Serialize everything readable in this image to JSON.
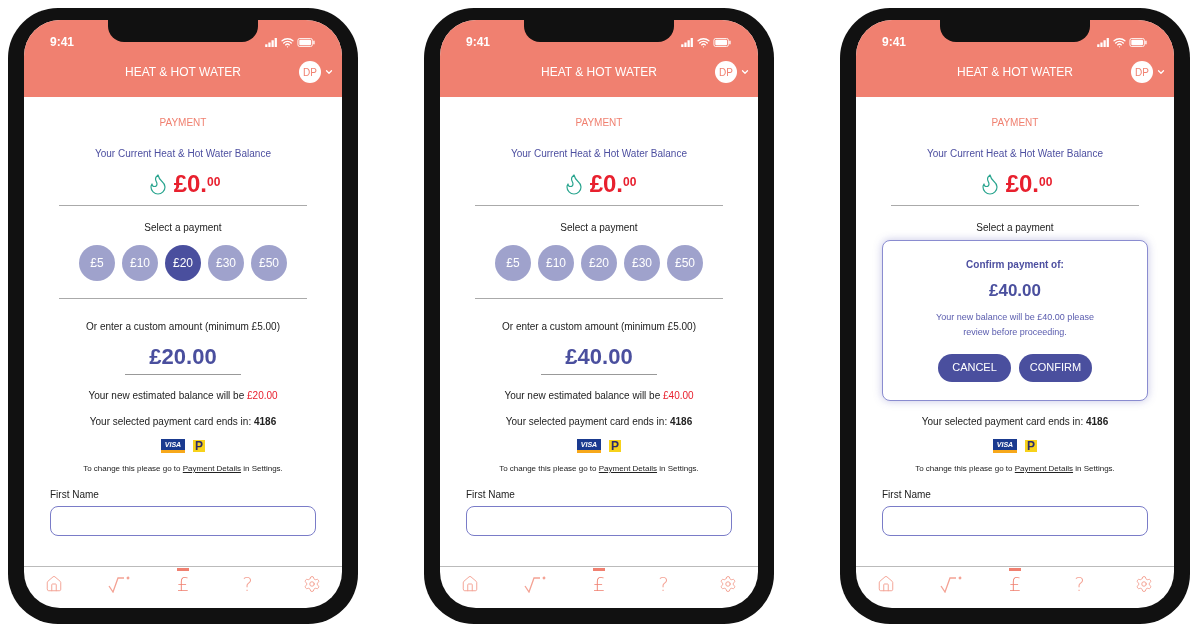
{
  "phones": [
    {
      "status": {
        "time": "9:41"
      },
      "header": {
        "title": "HEAT & HOT WATER",
        "avatar": "DP"
      },
      "section_title": "PAYMENT",
      "balance_label": "Your Current Heat & Hot Water Balance",
      "balance": "£0.$^{00}$",
      "select_label": "Select a payment",
      "chips": [
        {
          "label": "£5",
          "selected": false
        },
        {
          "label": "£10",
          "selected": false
        },
        {
          "label": "£20",
          "selected": true
        },
        {
          "label": "£30",
          "selected": false
        },
        {
          "label": "£50",
          "selected": false
        }
      ],
      "custom_label": "Or enter a custom amount (minimum £5.00)",
      "custom_amount": "£20.00",
      "estimate_label": "Your new estimated balance will be",
      "estimate_value": "£20.00",
      "card_text": "Your selected payment card ends in: **4186**",
      "logos": [
        {
          "kind": "visa",
          "text": "VISA"
        },
        {
          "kind": "paypoint",
          "text": "P"
        }
      ],
      "change_before": "To change this please go to",
      "change_link": "Payment Details",
      "change_after": "in Settings.",
      "first_name_label": "First Name",
      "tabs": [
        {
          "kind": "home",
          "selected": false
        },
        {
          "kind": "trend",
          "selected": false
        },
        {
          "kind": "glyph",
          "glyph": "£",
          "selected": true
        },
        {
          "kind": "glyph",
          "glyph": "?",
          "selected": false
        },
        {
          "kind": "settings",
          "selected": false
        }
      ]
    },
    {
      "status": {
        "time": "9:41"
      },
      "header": {
        "title": "HEAT & HOT WATER",
        "avatar": "DP"
      },
      "section_title": "PAYMENT",
      "balance_label": "Your Current Heat & Hot Water Balance",
      "balance": "£0.$^{00}$",
      "select_label": "Select a payment",
      "chips": [
        {
          "label": "£5",
          "selected": false
        },
        {
          "label": "£10",
          "selected": false
        },
        {
          "label": "£20",
          "selected": false
        },
        {
          "label": "£30",
          "selected": false
        },
        {
          "label": "£50",
          "selected": false
        }
      ],
      "custom_label": "Or enter a custom amount (minimum £5.00)",
      "custom_amount": "£40.00",
      "estimate_label": "Your new estimated balance will be",
      "estimate_value": "£40.00",
      "card_text": "Your selected payment card ends in: **4186**",
      "logos": [
        {
          "kind": "visa",
          "text": "VISA"
        },
        {
          "kind": "paypoint",
          "text": "P"
        }
      ],
      "change_before": "To change this please go to",
      "change_link": "Payment Details",
      "change_after": "in Settings.",
      "first_name_label": "First Name",
      "tabs": [
        {
          "kind": "home",
          "selected": false
        },
        {
          "kind": "trend",
          "selected": false
        },
        {
          "kind": "glyph",
          "glyph": "£",
          "selected": true
        },
        {
          "kind": "glyph",
          "glyph": "?",
          "selected": false
        },
        {
          "kind": "settings",
          "selected": false
        }
      ]
    },
    {
      "status": {
        "time": "9:41"
      },
      "header": {
        "title": "HEAT & HOT WATER",
        "avatar": "DP"
      },
      "section_title": "PAYMENT",
      "balance_label": "Your Current Heat & Hot Water Balance",
      "balance": "£0.$^{00}$",
      "select_label": "Select a payment",
      "card_text": "Your selected payment card ends in: **4186**",
      "logos": [
        {
          "kind": "visa",
          "text": "VISA"
        },
        {
          "kind": "paypoint",
          "text": "P"
        }
      ],
      "change_before": "To change this please go to",
      "change_link": "Payment Details",
      "change_after": "in Settings.",
      "first_name_label": "First Name",
      "dialog": {
        "title": "Confirm payment of:",
        "amount": "£40.00",
        "message": "Your new balance will be £40.00 please review before proceeding.",
        "buttons": [
          "CANCEL",
          "CONFIRM"
        ]
      },
      "tabs": [
        {
          "kind": "home",
          "selected": false
        },
        {
          "kind": "trend",
          "selected": false
        },
        {
          "kind": "glyph",
          "glyph": "£",
          "selected": true
        },
        {
          "kind": "glyph",
          "glyph": "?",
          "selected": false
        },
        {
          "kind": "settings",
          "selected": false
        }
      ]
    }
  ]
}
